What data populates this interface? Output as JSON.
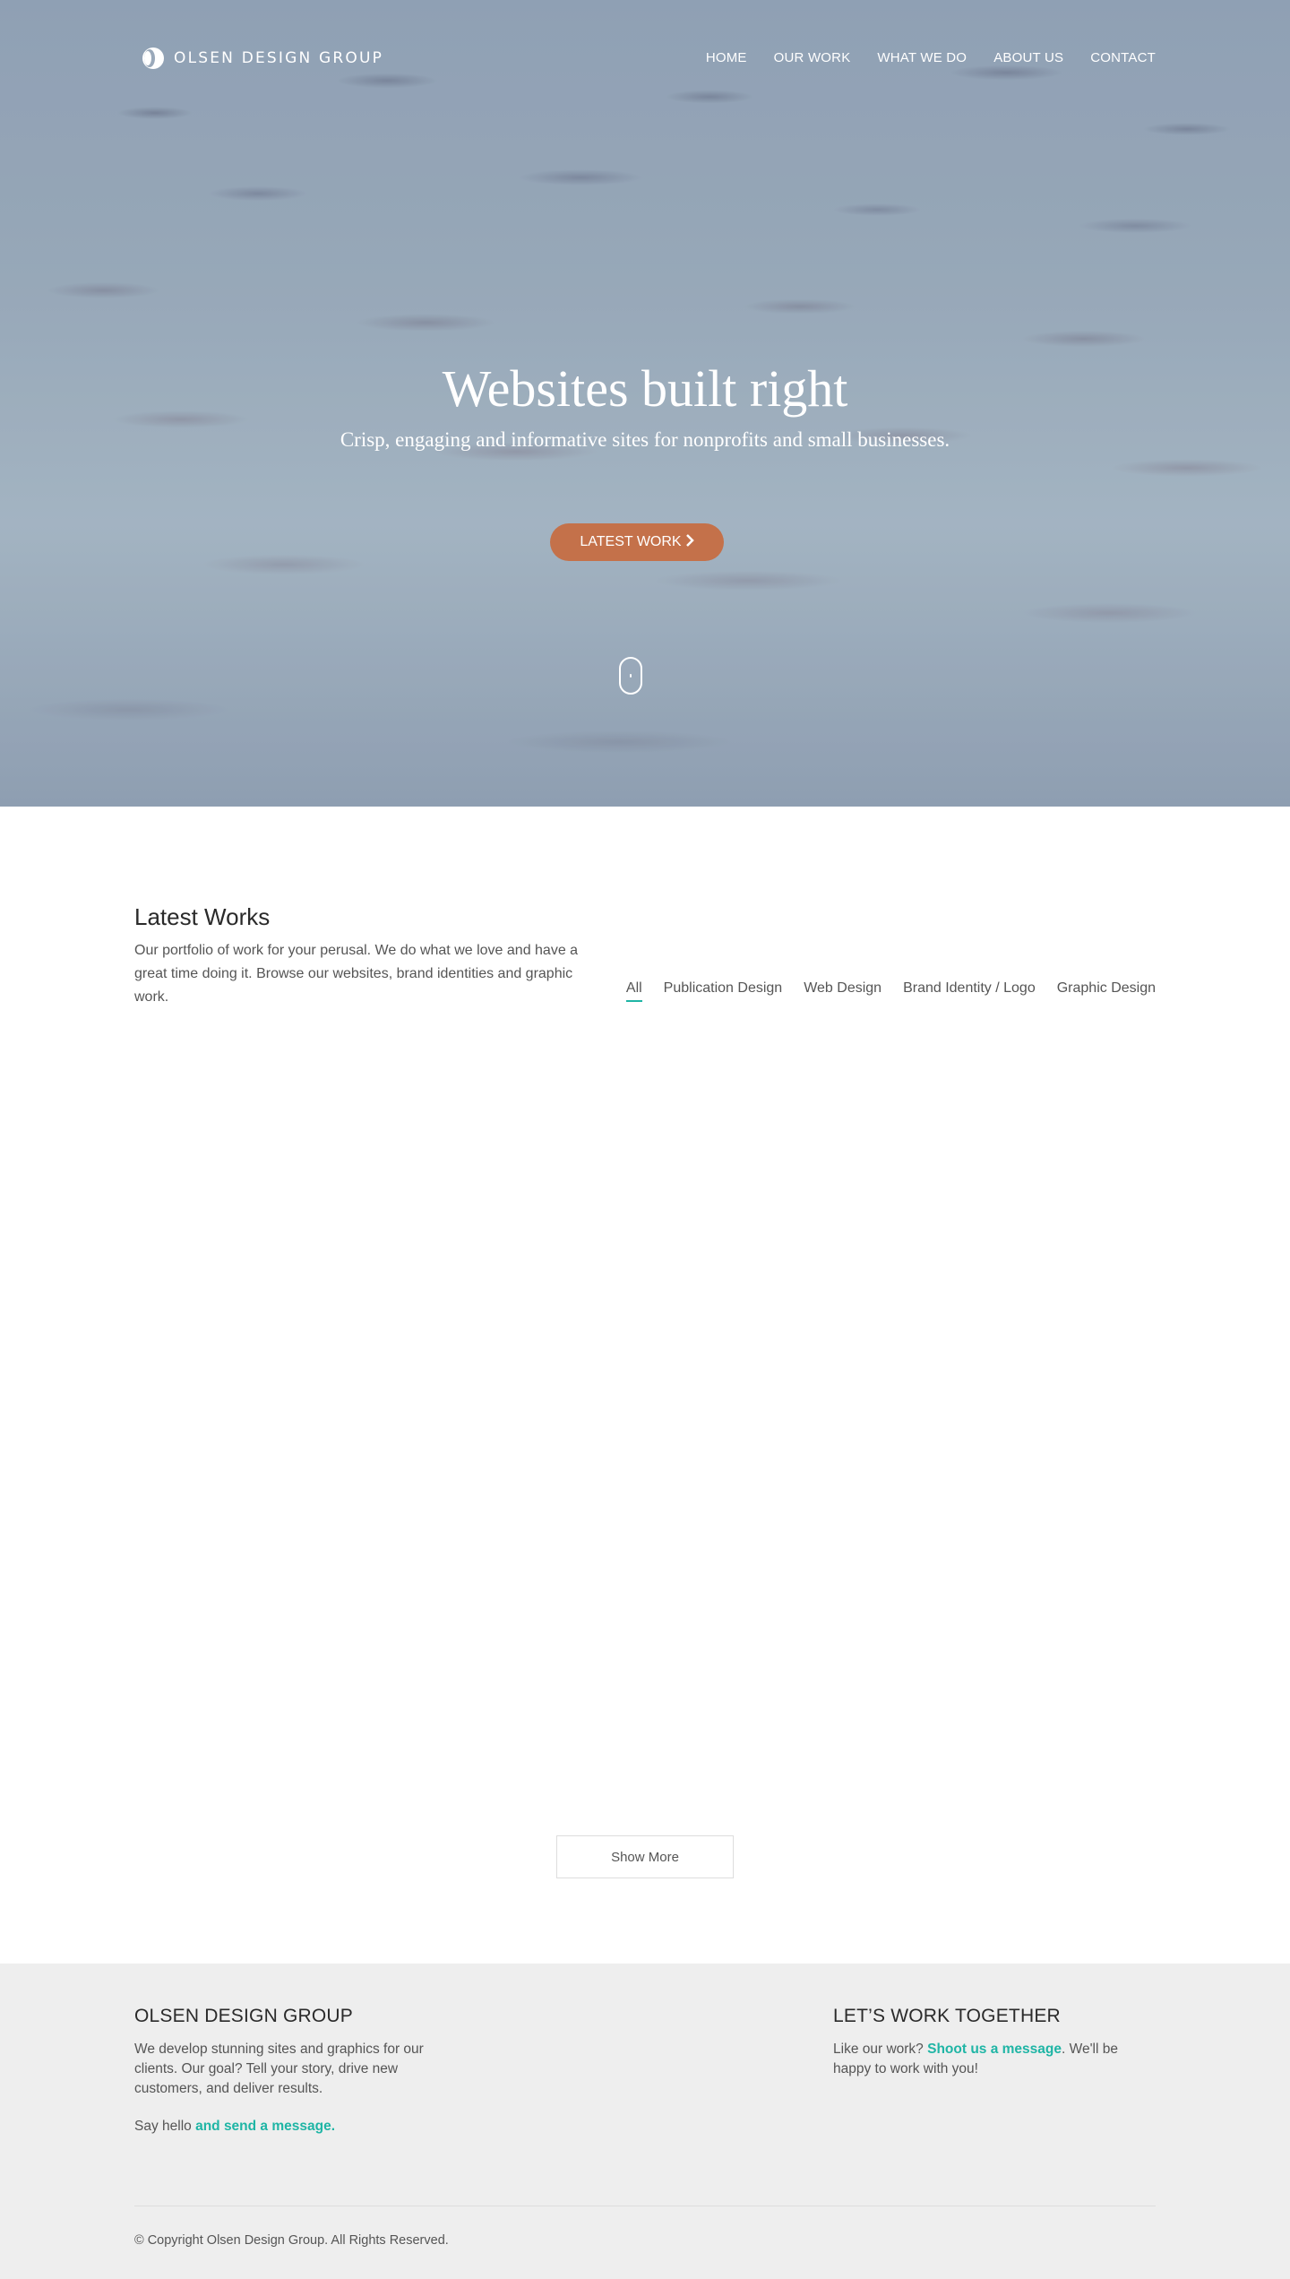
{
  "header": {
    "logo_text": "OLSEN DESIGN GROUP",
    "nav": [
      "HOME",
      "OUR WORK",
      "WHAT WE DO",
      "ABOUT US",
      "CONTACT"
    ]
  },
  "hero": {
    "title": "Websites built right",
    "subtitle": "Crisp, engaging and informative sites for nonprofits and small businesses.",
    "cta_label": "LATEST WORK",
    "cta_color": "#c4714a"
  },
  "works": {
    "title": "Latest Works",
    "description": "Our portfolio of work for your perusal. We do what we love and have a great time doing it. Browse our websites, brand identities and graphic work.",
    "filters": [
      "All",
      "Publication Design",
      "Web Design",
      "Brand Identity / Logo",
      "Graphic Design"
    ],
    "active_filter": "All",
    "show_more_label": "Show More"
  },
  "footer": {
    "left_title": "OLSEN DESIGN GROUP",
    "left_text": "We develop stunning sites and graphics for our clients. Our goal? Tell your story, drive new customers, and deliver results.",
    "hello_prefix": "Say hello ",
    "hello_link": "and send a message.",
    "right_title": "LET’S WORK TOGETHER",
    "right_prefix": "Like our work? ",
    "right_link": "Shoot us a message",
    "right_suffix": ". We'll be happy to work with you!",
    "copyright": "© Copyright Olsen Design Group. All Rights Reserved.",
    "accent_color": "#1fb5a5"
  }
}
